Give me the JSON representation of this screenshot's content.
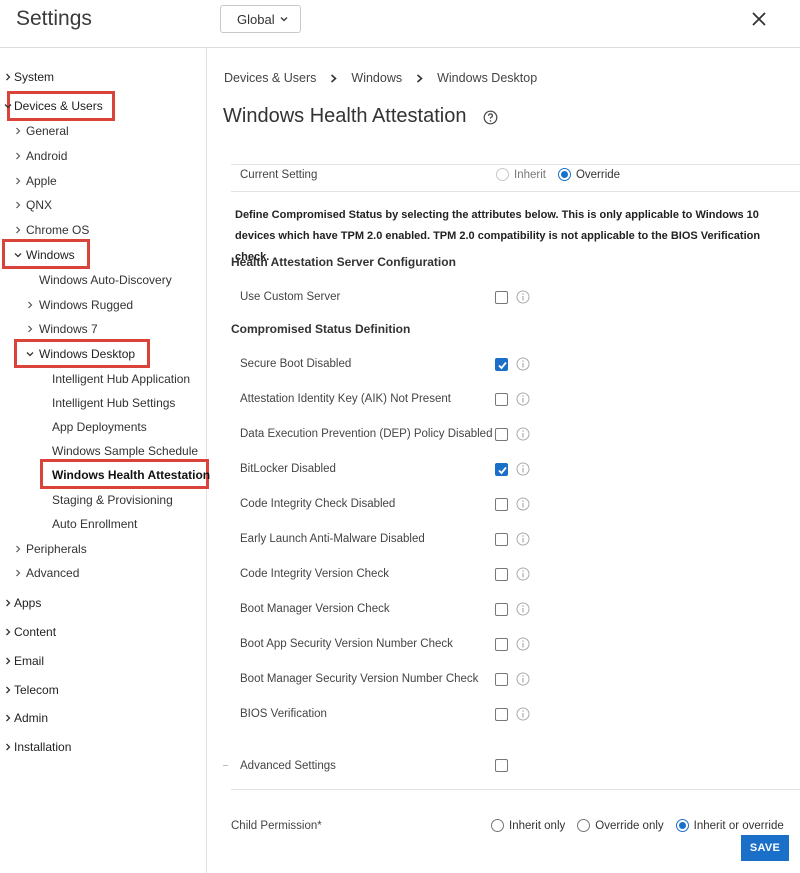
{
  "header": {
    "title": "Settings",
    "scope": "Global",
    "close_icon": "close-icon"
  },
  "sidebar": {
    "items": [
      {
        "label": "System"
      },
      {
        "label": "Devices & Users"
      },
      {
        "label": "General"
      },
      {
        "label": "Android"
      },
      {
        "label": "Apple"
      },
      {
        "label": "QNX"
      },
      {
        "label": "Chrome OS"
      },
      {
        "label": "Windows"
      },
      {
        "label": "Windows Auto-Discovery"
      },
      {
        "label": "Windows Rugged"
      },
      {
        "label": "Windows 7"
      },
      {
        "label": "Windows Desktop"
      },
      {
        "label": "Intelligent Hub Application"
      },
      {
        "label": "Intelligent Hub Settings"
      },
      {
        "label": "App Deployments"
      },
      {
        "label": "Windows Sample Schedule"
      },
      {
        "label": "Windows Health Attestation"
      },
      {
        "label": "Staging & Provisioning"
      },
      {
        "label": "Auto Enrollment"
      },
      {
        "label": "Peripherals"
      },
      {
        "label": "Advanced"
      },
      {
        "label": "Apps"
      },
      {
        "label": "Content"
      },
      {
        "label": "Email"
      },
      {
        "label": "Telecom"
      },
      {
        "label": "Admin"
      },
      {
        "label": "Installation"
      }
    ]
  },
  "breadcrumb": [
    "Devices & Users",
    "Windows",
    "Windows Desktop"
  ],
  "page": {
    "title": "Windows Health Attestation",
    "current_setting_label": "Current Setting",
    "current_setting_options": [
      "Inherit",
      "Override"
    ],
    "current_setting_selected": "Override",
    "description": "Define Compromised Status by selecting the attributes below. This is only applicable to Windows 10 devices which have TPM 2.0 enabled. TPM 2.0 compatibility is not applicable to the BIOS Verification check.",
    "server_section_title": "Health Attestation Server Configuration",
    "custom_server_label": "Use Custom Server",
    "custom_server_checked": false,
    "status_section_title": "Compromised Status Definition",
    "attributes": [
      {
        "label": "Secure Boot Disabled",
        "checked": true
      },
      {
        "label": "Attestation Identity Key (AIK) Not Present",
        "checked": false
      },
      {
        "label": "Data Execution Prevention (DEP) Policy Disabled",
        "checked": false
      },
      {
        "label": "BitLocker Disabled",
        "checked": true
      },
      {
        "label": "Code Integrity Check Disabled",
        "checked": false
      },
      {
        "label": "Early Launch Anti-Malware Disabled",
        "checked": false
      },
      {
        "label": "Code Integrity Version Check",
        "checked": false
      },
      {
        "label": "Boot Manager Version Check",
        "checked": false
      },
      {
        "label": "Boot App Security Version Number Check",
        "checked": false
      },
      {
        "label": "Boot Manager Security Version Number Check",
        "checked": false
      },
      {
        "label": "BIOS Verification",
        "checked": false
      }
    ],
    "advanced_settings_label": "Advanced Settings",
    "advanced_settings_checked": false,
    "child_permission_label": "Child Permission*",
    "child_permission_options": [
      "Inherit only",
      "Override only",
      "Inherit or override"
    ],
    "child_permission_selected": "Inherit or override",
    "save_label": "SAVE"
  },
  "colors": {
    "accent": "#1a6fc9",
    "highlight": "#d9433a"
  }
}
